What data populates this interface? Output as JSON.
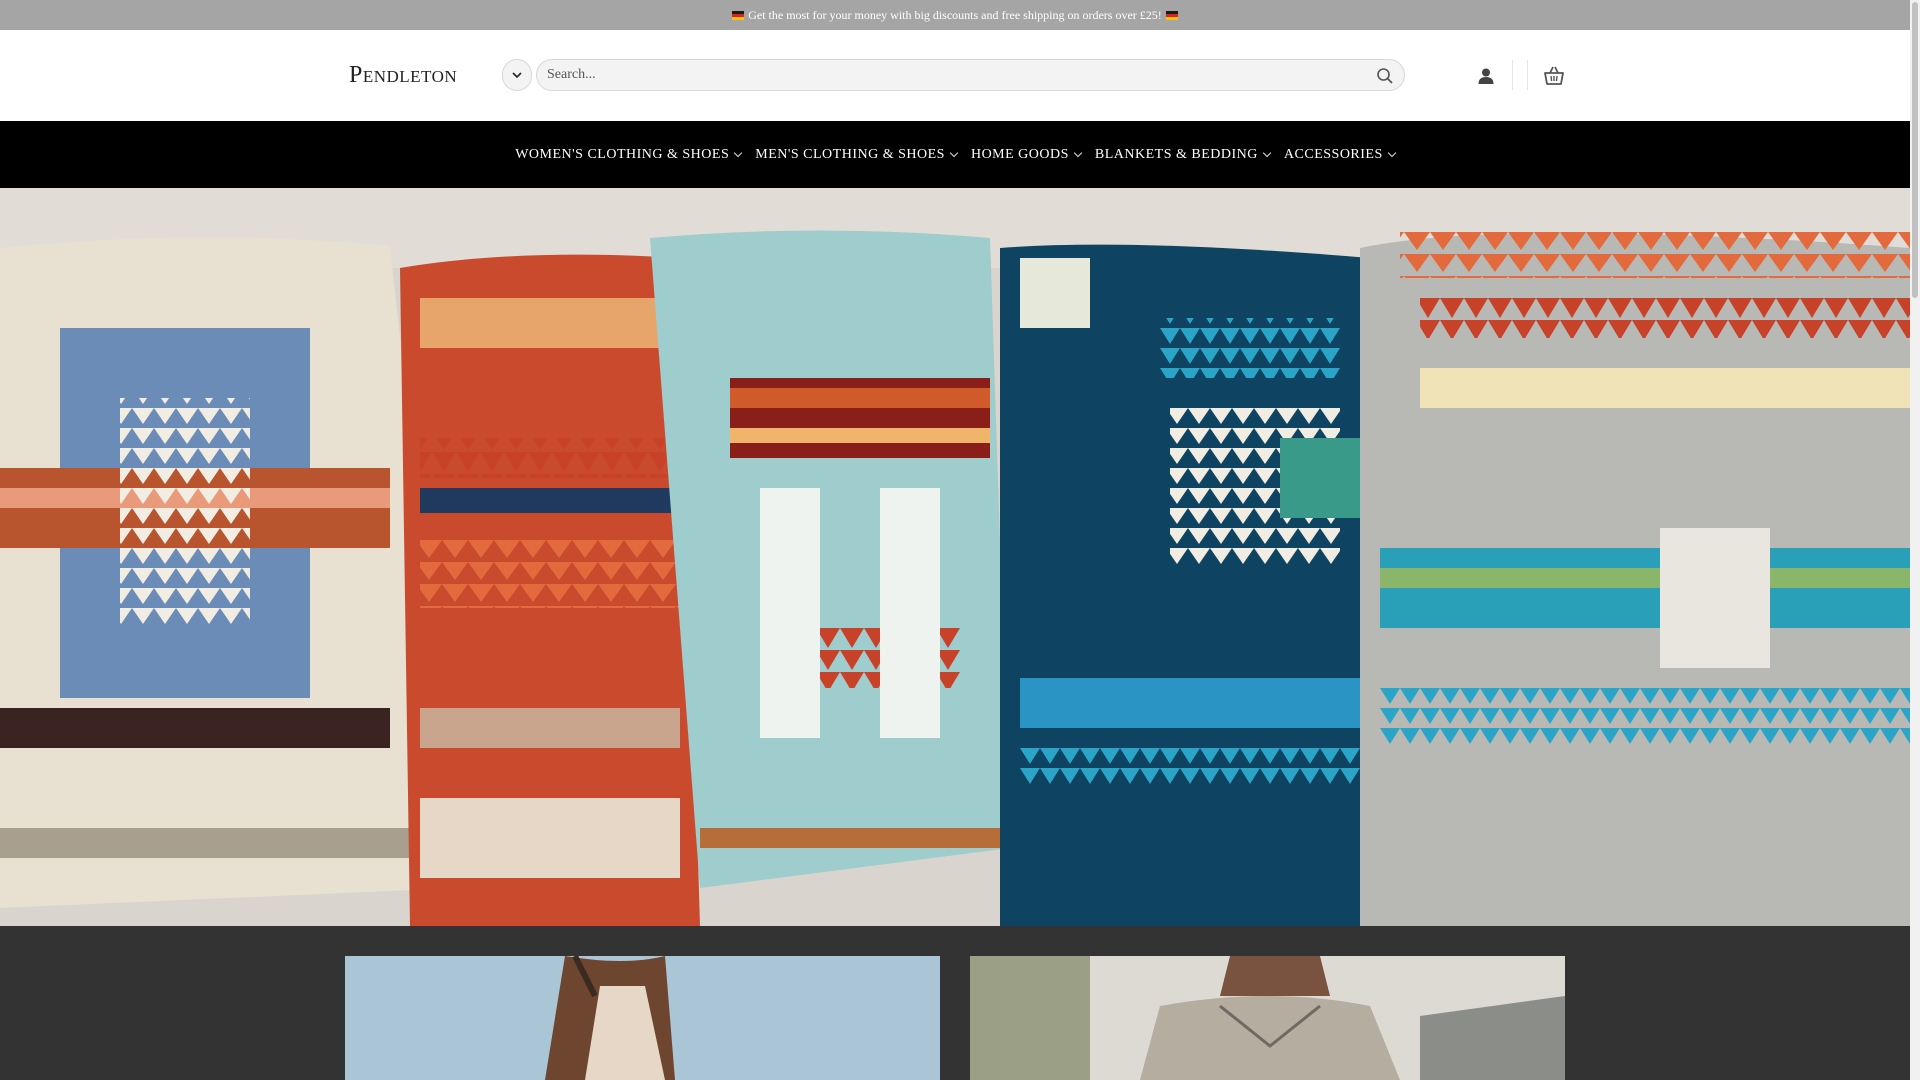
{
  "top_bar": {
    "message": "Get the most for your money with big discounts and free shipping on orders over £25!"
  },
  "header": {
    "logo_text": "Pendleton",
    "search": {
      "placeholder": "Search..."
    }
  },
  "nav": {
    "items": [
      {
        "label": "WOMEN'S CLOTHING & SHOES"
      },
      {
        "label": "MEN'S CLOTHING & SHOES"
      },
      {
        "label": "HOME GOODS"
      },
      {
        "label": "BLANKETS & BEDDING"
      },
      {
        "label": "ACCESSORIES"
      }
    ]
  },
  "colors": {
    "topbar_bg": "#a5a5a5",
    "nav_bg": "#000000",
    "promo_bg": "#333333"
  },
  "icons": [
    "chevron-down-icon",
    "search-icon",
    "user-icon",
    "basket-icon",
    "flag-icon"
  ]
}
